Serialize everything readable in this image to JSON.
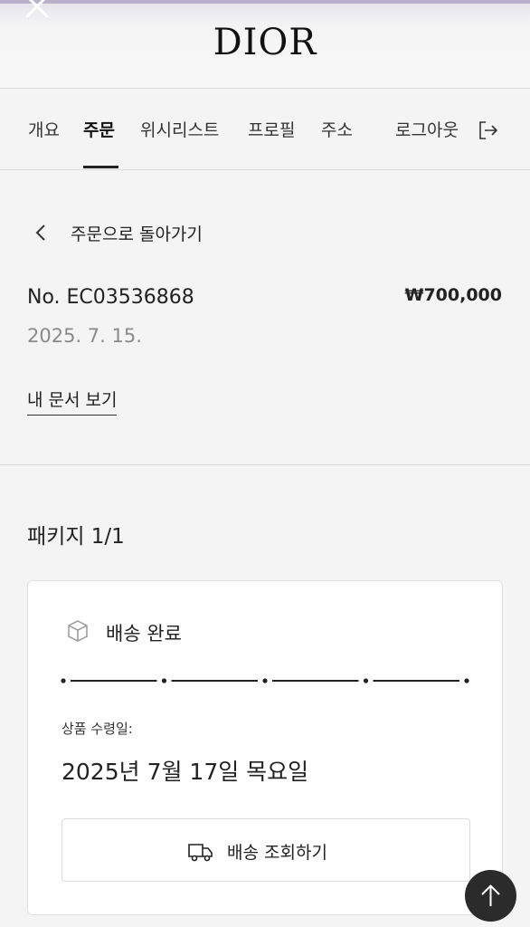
{
  "header": {
    "brand": "DIOR",
    "close_icon": "close-icon"
  },
  "tabs": [
    {
      "label": "개요",
      "active": false
    },
    {
      "label": "주문",
      "active": true
    },
    {
      "label": "위시리스트",
      "active": false
    },
    {
      "label": "프로필",
      "active": false
    },
    {
      "label": "주소",
      "active": false
    }
  ],
  "logout": {
    "label": "로그아웃",
    "icon": "logout-icon"
  },
  "back": {
    "label": "주문으로 돌아가기",
    "icon": "chevron-left-icon"
  },
  "order": {
    "number": "No. EC03536868",
    "price": "₩700,000",
    "date": "2025. 7. 15.",
    "documents_link": "내 문서 보기"
  },
  "package": {
    "title": "패키지 1/1",
    "status": "배송 완료",
    "status_icon": "package-box-icon",
    "progress_steps": 5,
    "progress_completed_steps": 5,
    "received_label": "상품 수령일:",
    "received_date": "2025년 7월 17일 목요일",
    "track_button": "배송 조회하기",
    "track_icon": "truck-icon"
  },
  "scroll_top_icon": "arrow-up-icon",
  "colors": {
    "background": "#f4f4f4",
    "card": "#ffffff",
    "text": "#222222",
    "muted": "#8a8a8a",
    "fab": "#2b2b2b",
    "top_accent": "#b9b2cc"
  }
}
